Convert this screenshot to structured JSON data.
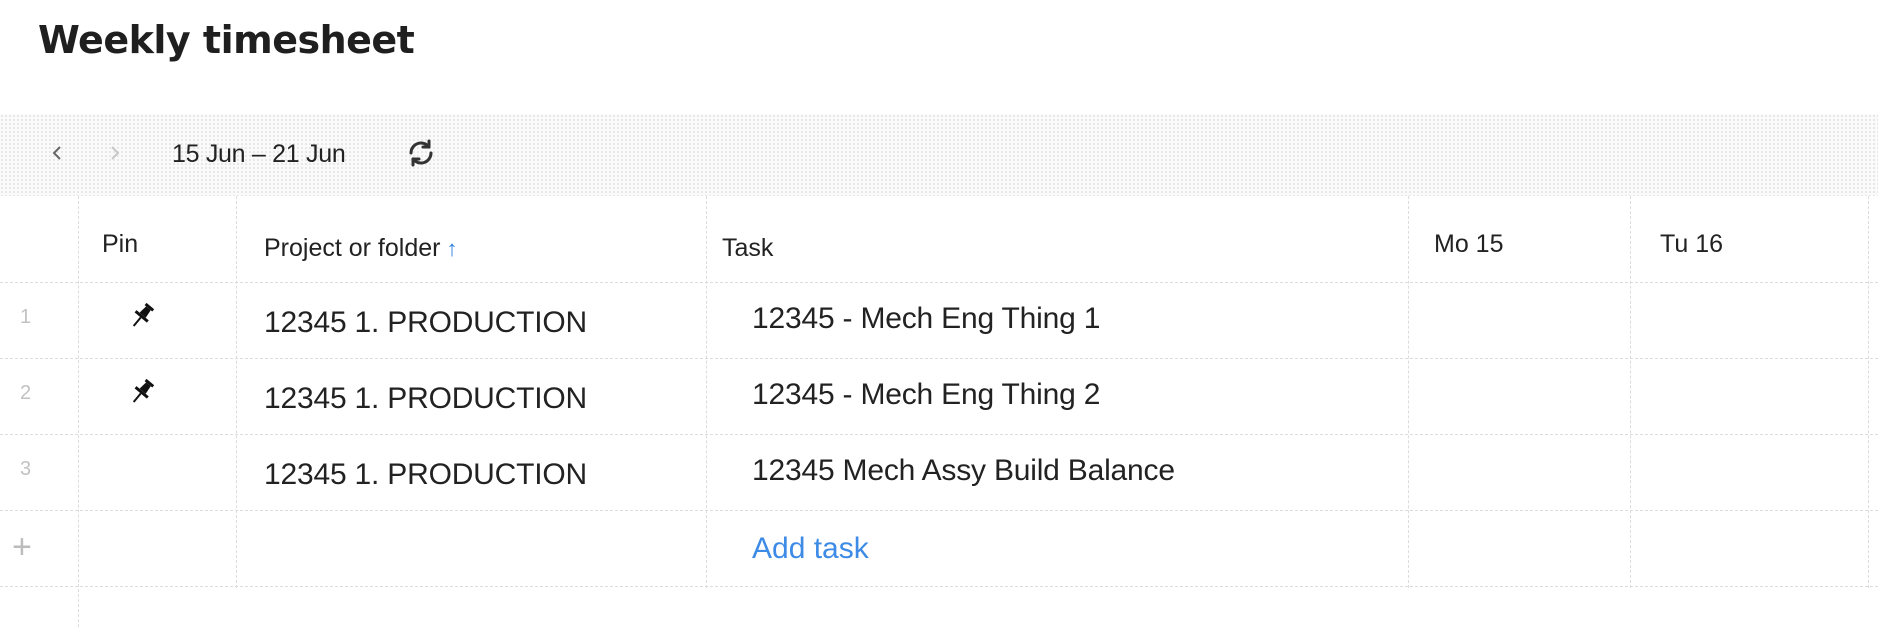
{
  "page": {
    "title": "Weekly timesheet"
  },
  "toolbar": {
    "prev_icon": "chevron-left-icon",
    "next_icon": "chevron-right-icon",
    "date_range": "15 Jun – 21 Jun",
    "refresh_icon": "refresh-icon"
  },
  "table": {
    "columns": {
      "pin": "Pin",
      "project": "Project or folder",
      "project_sort_icon": "↑",
      "task": "Task",
      "days": [
        "Mo 15",
        "Tu 16"
      ]
    },
    "rows": [
      {
        "num": "1",
        "pinned": true,
        "project": "12345 1. PRODUCTION",
        "task": "12345 - Mech Eng Thing 1"
      },
      {
        "num": "2",
        "pinned": true,
        "project": "12345 1. PRODUCTION",
        "task": "12345 - Mech Eng Thing 2"
      },
      {
        "num": "3",
        "pinned": false,
        "project": "12345 1. PRODUCTION",
        "task": "12345 Mech Assy Build Balance"
      }
    ],
    "add_row_icon": "+",
    "add_task_label": "Add task"
  },
  "colors": {
    "accent": "#3d8be6",
    "sort_icon": "#2d7fe0",
    "grid_line": "#dcdcdc",
    "row_number": "#c2c2c2"
  }
}
